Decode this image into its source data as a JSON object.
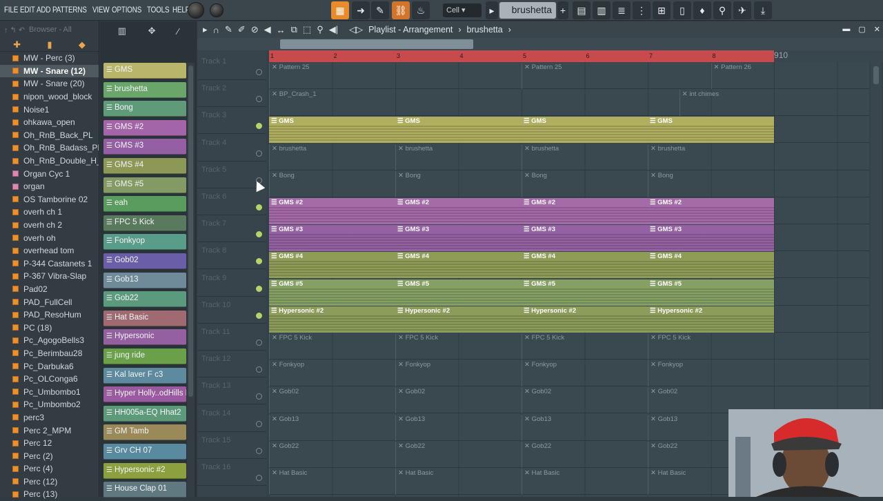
{
  "menu": [
    "FILE",
    "EDIT",
    "ADD",
    "PATTERNS",
    "VIEW",
    "OPTIONS",
    "TOOLS",
    "HELP"
  ],
  "toolbar": {
    "snap_label": "Cell",
    "pattern_name": "brushetta"
  },
  "browser": {
    "header": "Browser - All",
    "items": [
      {
        "label": "MW - Perc (3)",
        "icon": "folder-icon"
      },
      {
        "label": "MW - Snare (12)",
        "icon": "folder-icon",
        "selected": true
      },
      {
        "label": "MW - Snare (20)",
        "icon": "folder-icon"
      },
      {
        "label": "nipon_wood_block",
        "icon": "folder-icon"
      },
      {
        "label": "Noise1",
        "icon": "folder-icon"
      },
      {
        "label": "ohkawa_open",
        "icon": "folder-icon"
      },
      {
        "label": "Oh_RnB_Back_PL",
        "icon": "folder-icon"
      },
      {
        "label": "Oh_RnB_Badass_PL",
        "icon": "folder-icon"
      },
      {
        "label": "Oh_RnB_Double_H_PL",
        "icon": "folder-icon"
      },
      {
        "label": "Organ Cyc 1",
        "icon": "plugin-icon"
      },
      {
        "label": "organ",
        "icon": "plugin-icon"
      },
      {
        "label": "OS Tamborine 02",
        "icon": "folder-icon"
      },
      {
        "label": "overh ch 1",
        "icon": "folder-icon"
      },
      {
        "label": "overh ch 2",
        "icon": "folder-icon"
      },
      {
        "label": "overh oh",
        "icon": "folder-icon"
      },
      {
        "label": "overhead tom",
        "icon": "folder-icon"
      },
      {
        "label": "P-344 Castanets 1",
        "icon": "folder-icon"
      },
      {
        "label": "P-367 Vibra-Slap",
        "icon": "folder-icon"
      },
      {
        "label": "Pad02",
        "icon": "folder-icon"
      },
      {
        "label": "PAD_FullCell",
        "icon": "folder-icon"
      },
      {
        "label": "PAD_ResoHum",
        "icon": "folder-icon"
      },
      {
        "label": "PC (18)",
        "icon": "folder-icon"
      },
      {
        "label": "Pc_AgogoBells3",
        "icon": "folder-icon"
      },
      {
        "label": "Pc_Berimbau28",
        "icon": "folder-icon"
      },
      {
        "label": "Pc_Darbuka6",
        "icon": "folder-icon"
      },
      {
        "label": "Pc_OLConga6",
        "icon": "folder-icon"
      },
      {
        "label": "Pc_Umbombo1",
        "icon": "folder-icon"
      },
      {
        "label": "Pc_Umbombo2",
        "icon": "folder-icon"
      },
      {
        "label": "perc3",
        "icon": "folder-icon"
      },
      {
        "label": "Perc 2_MPM",
        "icon": "folder-icon"
      },
      {
        "label": "Perc 12",
        "icon": "folder-icon"
      },
      {
        "label": "Perc (2)",
        "icon": "folder-icon"
      },
      {
        "label": "Perc (4)",
        "icon": "folder-icon"
      },
      {
        "label": "Perc (12)",
        "icon": "folder-icon"
      },
      {
        "label": "Perc (13)",
        "icon": "folder-icon"
      }
    ]
  },
  "channels": [
    {
      "label": "GMS",
      "color": "#b9b56a"
    },
    {
      "label": "brushetta",
      "color": "#6aa56a"
    },
    {
      "label": "Bong",
      "color": "#5f9b78"
    },
    {
      "label": "GMS #2",
      "color": "#a365a8"
    },
    {
      "label": "GMS #3",
      "color": "#9460a3"
    },
    {
      "label": "GMS #4",
      "color": "#8d9856"
    },
    {
      "label": "GMS #5",
      "color": "#849a64"
    },
    {
      "label": "eah",
      "color": "#5a9b5e"
    },
    {
      "label": "FPC 5 Kick",
      "color": "#5a7a5e"
    },
    {
      "label": "Fonkyop",
      "color": "#5a9c8a"
    },
    {
      "label": "Gob02",
      "color": "#6a5ea8"
    },
    {
      "label": "Gob13",
      "color": "#6f8a98"
    },
    {
      "label": "Gob22",
      "color": "#5c9a7e"
    },
    {
      "label": "Hat Basic",
      "color": "#a06a72"
    },
    {
      "label": "Hypersonic",
      "color": "#9460a0"
    },
    {
      "label": "jung ride",
      "color": "#6aa04a"
    },
    {
      "label": "Kal laver F c3",
      "color": "#5e8aa0"
    },
    {
      "label": "Hyper Holly..odHills Rim",
      "color": "#9a5aa0"
    },
    {
      "label": "HH005a-EQ Hhat2",
      "color": "#5c9a7a"
    },
    {
      "label": "GM Tamb",
      "color": "#9a8a5a"
    },
    {
      "label": "Grv CH 07",
      "color": "#5a8aa0"
    },
    {
      "label": "Hypersonic #2",
      "color": "#8da040"
    },
    {
      "label": "House Clap 01",
      "color": "#607880"
    }
  ],
  "playlist": {
    "title": "Playlist - Arrangement",
    "pattern": "brushetta",
    "bars": [
      "1",
      "2",
      "3",
      "4",
      "5",
      "6",
      "7",
      "8",
      "9",
      "10"
    ],
    "tracks": [
      {
        "name": "Track 1",
        "clips": [
          {
            "bar": 1,
            "label": "Pattern 25"
          },
          {
            "bar": 5,
            "label": "Pattern 25"
          },
          {
            "bar": 8,
            "label": "Pattern 26"
          }
        ]
      },
      {
        "name": "Track 2",
        "clips": [
          {
            "bar": 1,
            "label": "BP_Crash_1"
          },
          {
            "bar": 7.5,
            "label": "int chimes"
          }
        ]
      },
      {
        "name": "Track 3",
        "fill": "#b0ae5f",
        "clips": [
          {
            "bar": 1,
            "label": "GMS"
          },
          {
            "bar": 3,
            "label": "GMS"
          },
          {
            "bar": 5,
            "label": "GMS"
          },
          {
            "bar": 7,
            "label": "GMS"
          }
        ]
      },
      {
        "name": "Track 4",
        "clips": [
          {
            "bar": 1,
            "label": "brushetta"
          },
          {
            "bar": 3,
            "label": "brushetta"
          },
          {
            "bar": 5,
            "label": "brushetta"
          },
          {
            "bar": 7,
            "label": "brushetta"
          }
        ]
      },
      {
        "name": "Track 5",
        "clips": [
          {
            "bar": 1,
            "label": "Bong"
          },
          {
            "bar": 3,
            "label": "Bong"
          },
          {
            "bar": 5,
            "label": "Bong"
          },
          {
            "bar": 7,
            "label": "Bong"
          }
        ]
      },
      {
        "name": "Track 6",
        "fill": "#a56aa8",
        "clips": [
          {
            "bar": 1,
            "label": "GMS #2"
          },
          {
            "bar": 3,
            "label": "GMS #2"
          },
          {
            "bar": 5,
            "label": "GMS #2"
          },
          {
            "bar": 7,
            "label": "GMS #2"
          }
        ]
      },
      {
        "name": "Track 7",
        "fill": "#9462a2",
        "clips": [
          {
            "bar": 1,
            "label": "GMS #3"
          },
          {
            "bar": 3,
            "label": "GMS #3"
          },
          {
            "bar": 5,
            "label": "GMS #3"
          },
          {
            "bar": 7,
            "label": "GMS #3"
          }
        ]
      },
      {
        "name": "Track 8",
        "fill": "#8f9c58",
        "clips": [
          {
            "bar": 1,
            "label": "GMS #4"
          },
          {
            "bar": 3,
            "label": "GMS #4"
          },
          {
            "bar": 5,
            "label": "GMS #4"
          },
          {
            "bar": 7,
            "label": "GMS #4"
          }
        ]
      },
      {
        "name": "Track 9",
        "fill": "#86a064",
        "clips": [
          {
            "bar": 1,
            "label": "GMS #5"
          },
          {
            "bar": 3,
            "label": "GMS #5"
          },
          {
            "bar": 5,
            "label": "GMS #5"
          },
          {
            "bar": 7,
            "label": "GMS #5"
          }
        ]
      },
      {
        "name": "Track 10",
        "fill": "#8c9c5a",
        "clips": [
          {
            "bar": 1,
            "label": "Hypersonic #2"
          },
          {
            "bar": 3,
            "label": "Hypersonic #2"
          },
          {
            "bar": 5,
            "label": "Hypersonic #2"
          },
          {
            "bar": 7,
            "label": "Hypersonic #2"
          }
        ]
      },
      {
        "name": "Track 11",
        "clips": [
          {
            "bar": 1,
            "label": "FPC 5 Kick"
          },
          {
            "bar": 3,
            "label": "FPC 5 Kick"
          },
          {
            "bar": 5,
            "label": "FPC 5 Kick"
          },
          {
            "bar": 7,
            "label": "FPC 5 Kick"
          }
        ]
      },
      {
        "name": "Track 12",
        "clips": [
          {
            "bar": 1,
            "label": "Fonkyop"
          },
          {
            "bar": 3,
            "label": "Fonkyop"
          },
          {
            "bar": 5,
            "label": "Fonkyop"
          },
          {
            "bar": 7,
            "label": "Fonkyop"
          }
        ]
      },
      {
        "name": "Track 13",
        "clips": [
          {
            "bar": 1,
            "label": "Gob02"
          },
          {
            "bar": 3,
            "label": "Gob02"
          },
          {
            "bar": 5,
            "label": "Gob02"
          },
          {
            "bar": 7,
            "label": "Gob02"
          }
        ]
      },
      {
        "name": "Track 14",
        "clips": [
          {
            "bar": 1,
            "label": "Gob13"
          },
          {
            "bar": 3,
            "label": "Gob13"
          },
          {
            "bar": 5,
            "label": "Gob13"
          },
          {
            "bar": 7,
            "label": "Gob13"
          }
        ]
      },
      {
        "name": "Track 15",
        "clips": [
          {
            "bar": 1,
            "label": "Gob22"
          },
          {
            "bar": 3,
            "label": "Gob22"
          },
          {
            "bar": 5,
            "label": "Gob22"
          },
          {
            "bar": 7,
            "label": "Gob22"
          }
        ]
      },
      {
        "name": "Track 16",
        "clips": [
          {
            "bar": 1,
            "label": "Hat Basic"
          },
          {
            "bar": 3,
            "label": "Hat Basic"
          },
          {
            "bar": 5,
            "label": "Hat Basic"
          },
          {
            "bar": 7,
            "label": "Hat Basic"
          }
        ]
      }
    ]
  },
  "colors": {
    "accent": "#e98b2a",
    "ruler": "#c74a4d",
    "folder": "#e8912e"
  }
}
